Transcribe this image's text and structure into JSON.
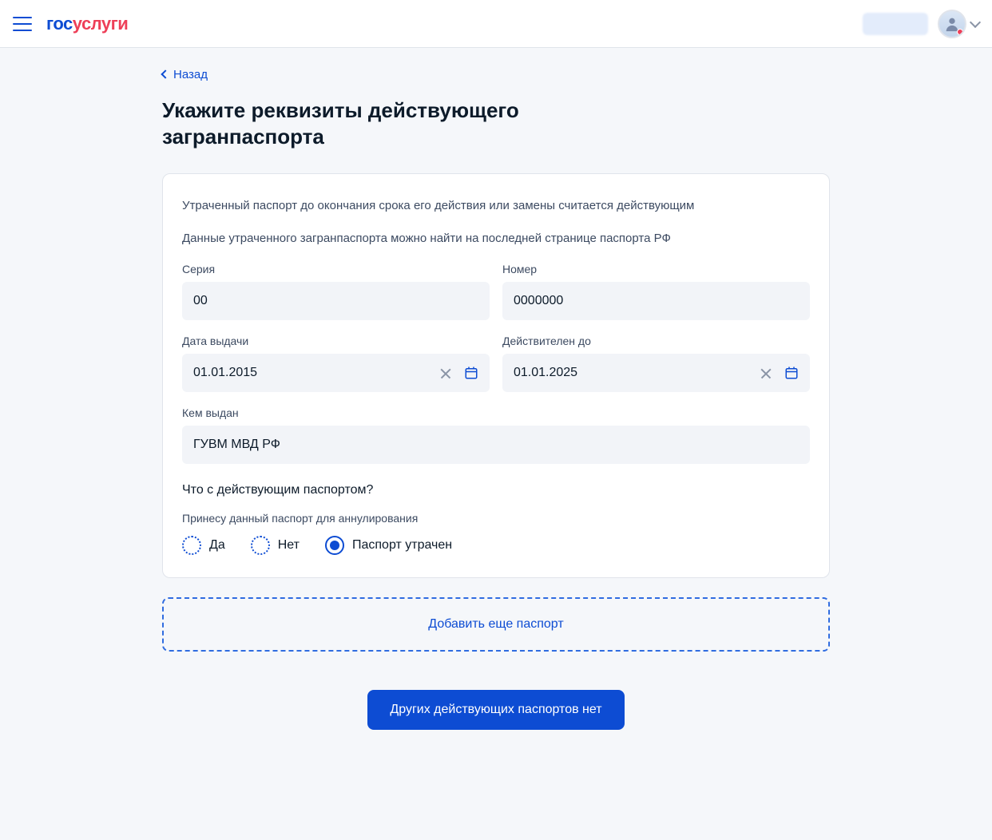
{
  "header": {
    "logo_part1": "гос",
    "logo_part2": "услуги"
  },
  "back_label": "Назад",
  "page_title": "Укажите реквизиты действующего загранпаспорта",
  "info_text1": "Утраченный паспорт до окончания срока его действия или замены считается действующим",
  "info_text2": "Данные утраченного загранпаспорта можно найти на последней странице паспорта РФ",
  "fields": {
    "series_label": "Серия",
    "series_value": "00",
    "number_label": "Номер",
    "number_value": "0000000",
    "issue_date_label": "Дата выдачи",
    "issue_date_value": "01.01.2015",
    "valid_until_label": "Действителен до",
    "valid_until_value": "01.01.2025",
    "issued_by_label": "Кем выдан",
    "issued_by_value": "ГУВМ МВД РФ"
  },
  "question": "Что с действующим паспортом?",
  "radio_header": "Принесу данный паспорт для аннулирования",
  "radios": {
    "yes": "Да",
    "no": "Нет",
    "lost": "Паспорт утрачен"
  },
  "add_button": "Добавить еще паспорт",
  "submit_button": "Других действующих паспортов нет"
}
